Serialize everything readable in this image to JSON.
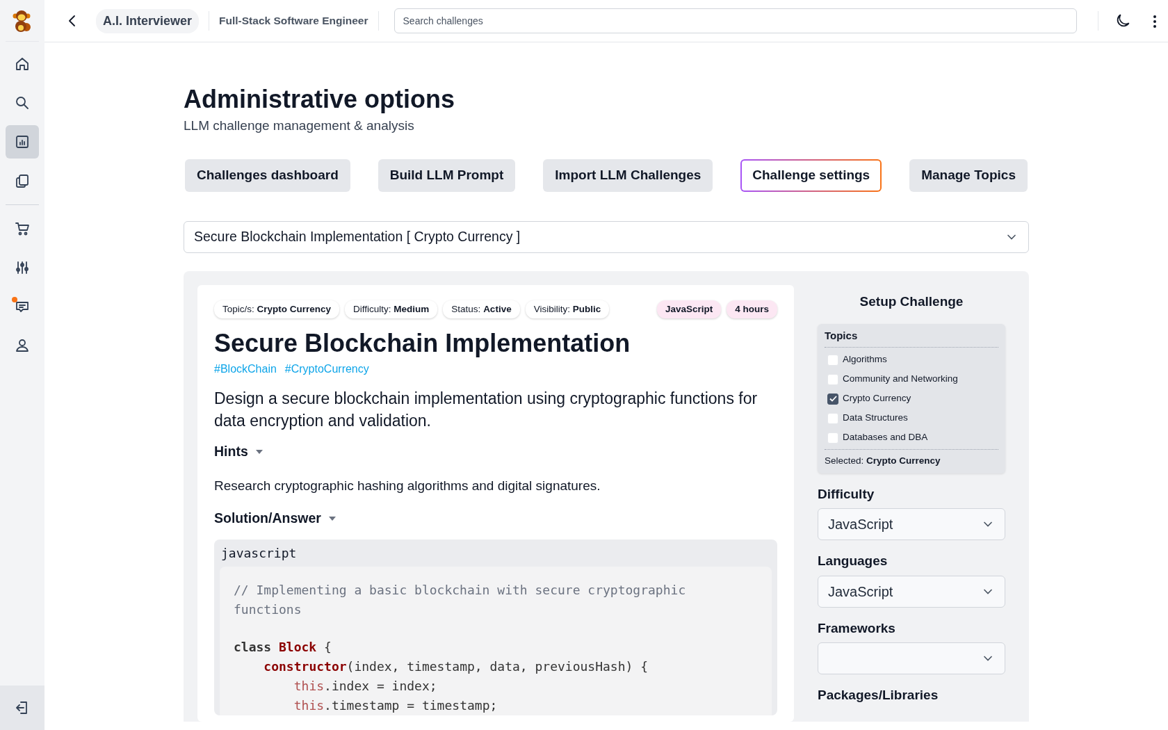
{
  "topbar": {
    "app_name": "A.I. Interviewer",
    "role": "Full-Stack Software Engineer",
    "search": {
      "placeholder": "Search challenges"
    }
  },
  "sidebar": {
    "items": [
      {
        "kind": "home",
        "selected": false,
        "notification": false
      },
      {
        "kind": "search",
        "selected": false,
        "notification": false
      },
      {
        "kind": "chart",
        "selected": true,
        "notification": false
      },
      {
        "kind": "copy",
        "selected": false,
        "notification": false
      },
      {
        "kind": "divider"
      },
      {
        "kind": "cart",
        "selected": false,
        "notification": false
      },
      {
        "kind": "sliders",
        "selected": false,
        "notification": false
      },
      {
        "kind": "message",
        "selected": false,
        "notification": true
      },
      {
        "kind": "user",
        "selected": false,
        "notification": false
      }
    ]
  },
  "page": {
    "title": "Administrative options",
    "subtitle": "LLM challenge management & analysis"
  },
  "tabs": [
    {
      "label": "Challenges dashboard",
      "selected": false
    },
    {
      "label": "Build LLM Prompt",
      "selected": false
    },
    {
      "label": "Import LLM Challenges",
      "selected": false
    },
    {
      "label": "Challenge settings",
      "selected": true
    },
    {
      "label": "Manage Topics",
      "selected": false
    }
  ],
  "challenge_select": {
    "value": "Secure Blockchain Implementation [ Crypto Currency ]"
  },
  "challenge": {
    "meta": [
      {
        "label": "Topic/s:",
        "value": "Crypto Currency"
      },
      {
        "label": "Difficulty:",
        "value": "Medium"
      },
      {
        "label": "Status:",
        "value": "Active"
      },
      {
        "label": "Visibility:",
        "value": "Public"
      }
    ],
    "tags": [
      "JavaScript",
      "4 hours"
    ],
    "title": "Secure Blockchain Implementation",
    "hashtags": [
      "#BlockChain",
      "#CryptoCurrency"
    ],
    "description": "Design a secure blockchain implementation using cryptographic functions for data encryption and validation.",
    "hints": {
      "label": "Hints",
      "expanded": true,
      "text": "Research cryptographic hashing algorithms and digital signatures."
    },
    "solution": {
      "label": "Solution/Answer",
      "expanded": true,
      "language": "javascript",
      "code": [
        {
          "blank_before": false,
          "tokens": [
            {
              "kind": "comment",
              "text": "// Implementing a basic blockchain with secure cryptographic functions"
            }
          ]
        },
        {
          "blank_before": true,
          "tokens": [
            {
              "kind": "keyword",
              "text": "class"
            },
            {
              "kind": "type",
              "text": " Block"
            },
            {
              "kind": "plain",
              "text": " {"
            }
          ]
        },
        {
          "blank_before": false,
          "tokens": [
            {
              "kind": "function",
              "text": "    constructor"
            },
            {
              "kind": "plain",
              "text": "(index, timestamp, data, previousHash) {"
            }
          ]
        },
        {
          "blank_before": false,
          "tokens": [
            {
              "kind": "this",
              "text": "        this"
            },
            {
              "kind": "plain",
              "text": ".index = index;"
            }
          ]
        },
        {
          "blank_before": false,
          "tokens": [
            {
              "kind": "this",
              "text": "        this"
            },
            {
              "kind": "plain",
              "text": ".timestamp = timestamp;"
            }
          ]
        }
      ]
    }
  },
  "setup": {
    "title": "Setup Challenge",
    "topics": {
      "label": "Topics",
      "items": [
        {
          "label": "Algorithms",
          "checked": false
        },
        {
          "label": "Community and Networking",
          "checked": false
        },
        {
          "label": "Crypto Currency",
          "checked": true
        },
        {
          "label": "Data Structures",
          "checked": false
        },
        {
          "label": "Databases and DBA",
          "checked": false
        }
      ],
      "selected_label": "Selected:",
      "selected_value": "Crypto Currency"
    },
    "fields": [
      {
        "label": "Difficulty",
        "value": "JavaScript"
      },
      {
        "label": "Languages",
        "value": "JavaScript"
      },
      {
        "label": "Frameworks"
      },
      {
        "label": "Packages/Libraries"
      }
    ]
  }
}
